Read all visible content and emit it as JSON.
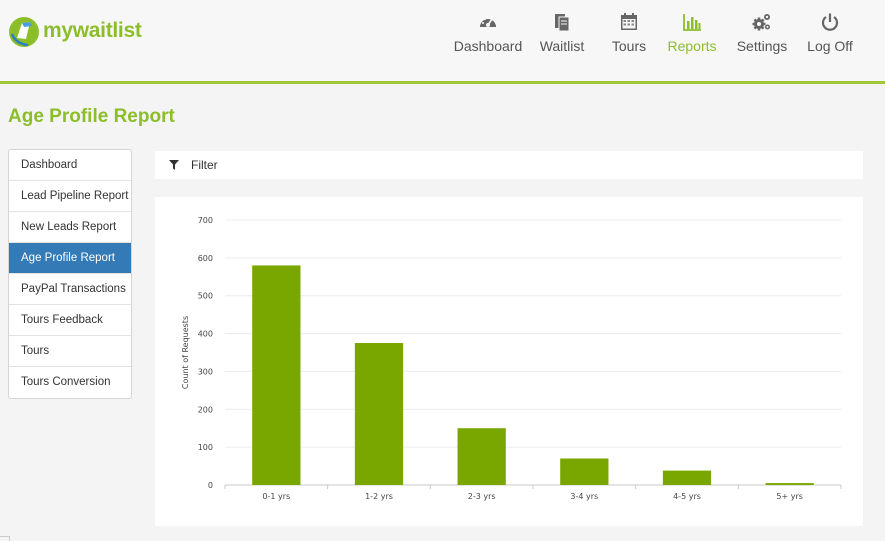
{
  "app": {
    "logo_text": "mywaitlist"
  },
  "nav": [
    {
      "label": "Dashboard",
      "icon": "dashboard-gauge-icon",
      "active": false
    },
    {
      "label": "Waitlist",
      "icon": "waitlist-documents-icon",
      "active": false
    },
    {
      "label": "Tours",
      "icon": "calendar-icon",
      "active": false
    },
    {
      "label": "Reports",
      "icon": "bar-chart-icon",
      "active": true
    },
    {
      "label": "Settings",
      "icon": "gears-icon",
      "active": false
    },
    {
      "label": "Log Off",
      "icon": "power-icon",
      "active": false
    }
  ],
  "page": {
    "title": "Age Profile Report"
  },
  "sidebar": {
    "items": [
      {
        "label": "Dashboard",
        "active": false
      },
      {
        "label": "Lead Pipeline Report",
        "active": false
      },
      {
        "label": "New Leads Report",
        "active": false
      },
      {
        "label": "Age Profile Report",
        "active": true
      },
      {
        "label": "PayPal Transactions",
        "active": false
      },
      {
        "label": "Tours Feedback",
        "active": false
      },
      {
        "label": "Tours",
        "active": false
      },
      {
        "label": "Tours Conversion",
        "active": false
      }
    ]
  },
  "filter": {
    "label": "Filter",
    "icon": "filter-funnel-icon"
  },
  "colors": {
    "accent": "#8cbe2a",
    "bar": "#7aa600",
    "active_side": "#337ab7"
  },
  "chart_data": {
    "type": "bar",
    "categories": [
      "0-1 yrs",
      "1-2 yrs",
      "2-3 yrs",
      "3-4 yrs",
      "4-5 yrs",
      "5+ yrs"
    ],
    "values": [
      580,
      375,
      150,
      70,
      38,
      5
    ],
    "xlabel": "",
    "ylabel": "Count of Requests",
    "ylim": [
      0,
      700
    ],
    "yticks": [
      0,
      100,
      200,
      300,
      400,
      500,
      600,
      700
    ],
    "grid": true,
    "legend": "none"
  }
}
